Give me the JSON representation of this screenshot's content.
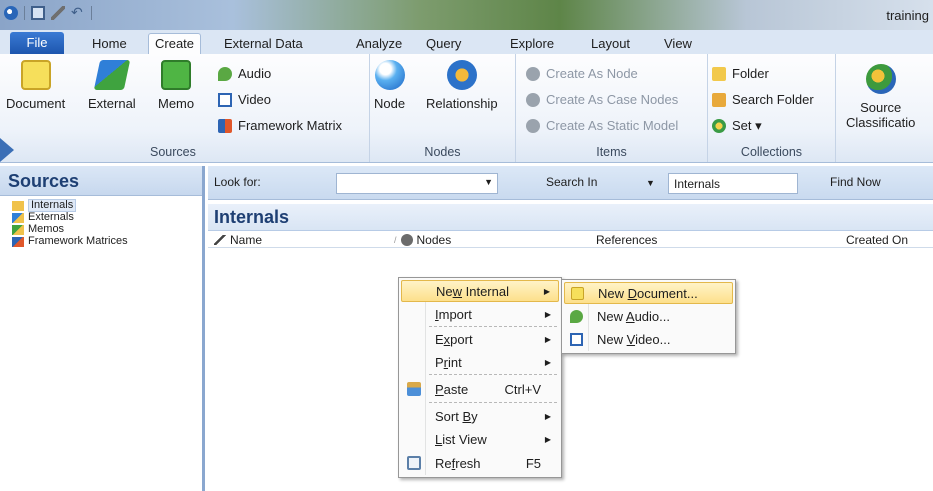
{
  "window": {
    "title": "training"
  },
  "ribbon_tabs": [
    {
      "label": "File"
    },
    {
      "label": "Home"
    },
    {
      "label": "Create"
    },
    {
      "label": "External Data"
    },
    {
      "label": "Analyze"
    },
    {
      "label": "Query"
    },
    {
      "label": "Explore"
    },
    {
      "label": "Layout"
    },
    {
      "label": "View"
    }
  ],
  "ribbon": {
    "sources": {
      "label": "Sources",
      "document": "Document",
      "external": "External",
      "memo": "Memo",
      "audio": "Audio",
      "video": "Video",
      "framework_matrix": "Framework Matrix"
    },
    "nodes": {
      "label": "Nodes",
      "node": "Node",
      "relationship": "Relationship"
    },
    "items": {
      "label": "Items",
      "create_as_node": "Create As Node",
      "create_as_case_nodes": "Create As Case Nodes",
      "create_as_static_model": "Create As Static Model"
    },
    "collections": {
      "label": "Collections",
      "folder": "Folder",
      "search_folder": "Search Folder",
      "set": "Set ▾"
    },
    "classification": {
      "source_line1": "Source",
      "source_line2": "Classificatio"
    }
  },
  "nav": {
    "header": "Sources",
    "items": [
      {
        "label": "Internals"
      },
      {
        "label": "Externals"
      },
      {
        "label": "Memos"
      },
      {
        "label": "Framework Matrices"
      }
    ]
  },
  "search": {
    "look_for_label": "Look for:",
    "look_for_value": "",
    "search_in_label": "Search In",
    "search_in_value": "Internals",
    "find_now": "Find Now"
  },
  "content": {
    "title": "Internals",
    "columns": {
      "name": "Name",
      "nodes": "Nodes",
      "references": "References",
      "created_on": "Created On"
    }
  },
  "context_menu": {
    "new_internal": {
      "pre": "Ne",
      "key": "w",
      "post": " Internal"
    },
    "import": {
      "pre": "",
      "key": "I",
      "post": "mport"
    },
    "export": {
      "pre": "E",
      "key": "x",
      "post": "port"
    },
    "print": {
      "pre": "P",
      "key": "r",
      "post": "int"
    },
    "paste": {
      "pre": "",
      "key": "P",
      "post": "aste",
      "shortcut": "Ctrl+V"
    },
    "sort_by": {
      "pre": "Sort ",
      "key": "B",
      "post": "y"
    },
    "list_view": {
      "pre": "",
      "key": "L",
      "post": "ist View"
    },
    "refresh": {
      "pre": "Re",
      "key": "f",
      "post": "resh",
      "shortcut": "F5"
    }
  },
  "submenu": {
    "new_document": {
      "pre": "New ",
      "key": "D",
      "post": "ocument..."
    },
    "new_audio": {
      "pre": "New ",
      "key": "A",
      "post": "udio..."
    },
    "new_video": {
      "pre": "New ",
      "key": "V",
      "post": "ideo..."
    }
  }
}
